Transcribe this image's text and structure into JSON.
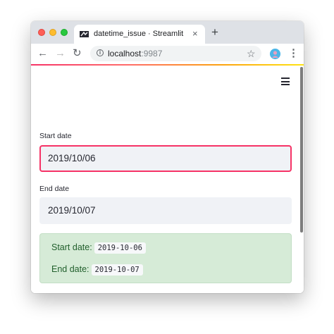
{
  "browser": {
    "tab": {
      "title": "datetime_issue · Streamlit",
      "close_glyph": "×",
      "favicon": "streamlit-logo-icon"
    },
    "new_tab_glyph": "+",
    "nav": {
      "back_glyph": "←",
      "forward_glyph": "→",
      "reload_glyph": "↻"
    },
    "address_bar": {
      "info_glyph": "i",
      "host": "localhost",
      "port": ":9987",
      "bookmark_glyph": "☆"
    },
    "menu_glyph": "⋮",
    "colors": {
      "titlebar": "#dee1e6",
      "accent_progress": "#f63366"
    }
  },
  "app": {
    "hamburger_icon": "hamburger-menu-icon",
    "start_date": {
      "label": "Start date",
      "value": "2019/10/06"
    },
    "end_date": {
      "label": "End date",
      "value": "2019/10/07"
    },
    "result": {
      "start_label": "Start date:",
      "start_value": "2019-10-06",
      "end_label": "End date:",
      "end_value": "2019-10-07"
    },
    "colors": {
      "focus_border": "#f63366",
      "input_bg": "#f0f2f6",
      "success_bg": "#d6ebd7",
      "success_text": "#215f2c"
    }
  }
}
